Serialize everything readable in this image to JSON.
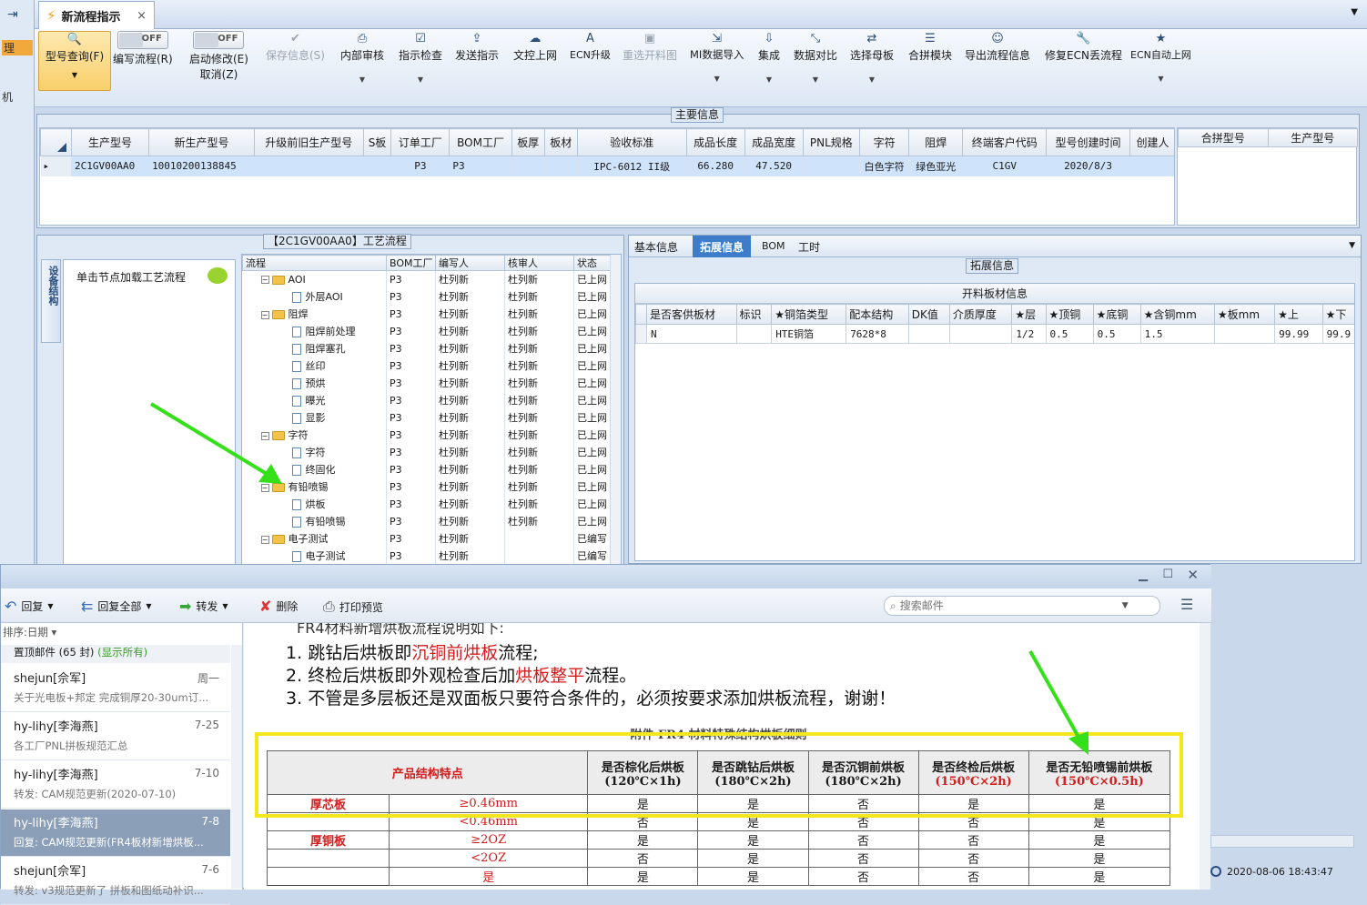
{
  "left_strip": {
    "items": [
      "理",
      "机"
    ]
  },
  "tab": {
    "title": "新流程指示",
    "close": "×"
  },
  "toolbar": {
    "query": "型号查询(F)",
    "toggle_off": "OFF",
    "edit_flow": "编写流程(R)",
    "start_modify": "启动修改(E)",
    "cancel": "取消(Z)",
    "save": "保存信息(S)",
    "internal_review": "内部审核",
    "check": "指示检查",
    "send": "发送指示",
    "upload": "文控上网",
    "ecn_upgrade": "ECN升级",
    "reselect": "重选开料图",
    "mi_import": "MI数据导入",
    "integrate": "集成",
    "compare": "数据对比",
    "select_master": "选择母板",
    "merge": "合拼模块",
    "export": "导出流程信息",
    "repair_ecn": "修复ECN丢流程",
    "ecn_auto": "ECN自动上网"
  },
  "main_info": {
    "title": "主要信息",
    "columns": [
      "生产型号",
      "新生产型号",
      "升级前旧生产型号",
      "S板",
      "订单工厂",
      "BOM工厂",
      "板厚",
      "板材",
      "验收标准",
      "成品长度",
      "成品宽度",
      "PNL规格",
      "字符",
      "阻焊",
      "终端客户代码",
      "型号创建时间",
      "创建人"
    ],
    "row": [
      "2C1GV00AA0",
      "10010200138845",
      "",
      "",
      "P3",
      "P3",
      "",
      "",
      "IPC-6012 II级",
      "66.280",
      "47.520",
      "",
      "白色字符",
      "绿色亚光",
      "C1GV",
      "2020/8/3",
      ""
    ],
    "merge_columns": [
      "合拼型号",
      "生产型号"
    ]
  },
  "process": {
    "title": "【2C1GV00AA0】工艺流程",
    "side_tab": "设备结构",
    "hint": "单击节点加载工艺流程",
    "columns": [
      "流程",
      "BOM工厂",
      "编写人",
      "核审人",
      "状态"
    ],
    "rows": [
      {
        "name": "AOI",
        "level": 0,
        "bom": "P3",
        "writer": "杜列新",
        "reviewer": "杜列新",
        "status": "已上网"
      },
      {
        "name": "外层AOI",
        "level": 1,
        "bom": "P3",
        "writer": "杜列新",
        "reviewer": "杜列新",
        "status": "已上网"
      },
      {
        "name": "阻焊",
        "level": 0,
        "bom": "P3",
        "writer": "杜列新",
        "reviewer": "杜列新",
        "status": "已上网"
      },
      {
        "name": "阻焊前处理",
        "level": 1,
        "bom": "P3",
        "writer": "杜列新",
        "reviewer": "杜列新",
        "status": "已上网"
      },
      {
        "name": "阻焊塞孔",
        "level": 1,
        "bom": "P3",
        "writer": "杜列新",
        "reviewer": "杜列新",
        "status": "已上网"
      },
      {
        "name": "丝印",
        "level": 1,
        "bom": "P3",
        "writer": "杜列新",
        "reviewer": "杜列新",
        "status": "已上网"
      },
      {
        "name": "预烘",
        "level": 1,
        "bom": "P3",
        "writer": "杜列新",
        "reviewer": "杜列新",
        "status": "已上网"
      },
      {
        "name": "曝光",
        "level": 1,
        "bom": "P3",
        "writer": "杜列新",
        "reviewer": "杜列新",
        "status": "已上网"
      },
      {
        "name": "显影",
        "level": 1,
        "bom": "P3",
        "writer": "杜列新",
        "reviewer": "杜列新",
        "status": "已上网"
      },
      {
        "name": "字符",
        "level": 0,
        "bom": "P3",
        "writer": "杜列新",
        "reviewer": "杜列新",
        "status": "已上网"
      },
      {
        "name": "字符",
        "level": 1,
        "bom": "P3",
        "writer": "杜列新",
        "reviewer": "杜列新",
        "status": "已上网"
      },
      {
        "name": "终固化",
        "level": 1,
        "bom": "P3",
        "writer": "杜列新",
        "reviewer": "杜列新",
        "status": "已上网"
      },
      {
        "name": "有铅喷锡",
        "level": 0,
        "bom": "P3",
        "writer": "杜列新",
        "reviewer": "杜列新",
        "status": "已上网"
      },
      {
        "name": "烘板",
        "level": 1,
        "bom": "P3",
        "writer": "杜列新",
        "reviewer": "杜列新",
        "status": "已上网"
      },
      {
        "name": "有铅喷锡",
        "level": 1,
        "bom": "P3",
        "writer": "杜列新",
        "reviewer": "杜列新",
        "status": "已上网"
      },
      {
        "name": "电子测试",
        "level": 0,
        "bom": "P3",
        "writer": "杜列新",
        "reviewer": "",
        "status": "已编写"
      },
      {
        "name": "电子测试",
        "level": 1,
        "bom": "P3",
        "writer": "杜列新",
        "reviewer": "",
        "status": "已编写"
      }
    ]
  },
  "right_panel": {
    "tabs": [
      "基本信息",
      "拓展信息",
      "BOM",
      "工时"
    ],
    "active_tab": "拓展信息",
    "group_title": "拓展信息",
    "table_title": "开料板材信息",
    "columns": [
      "是否客供板材",
      "标识",
      "★铜箔类型",
      "配本结构",
      "DK值",
      "介质厚度",
      "★层",
      "★顶铜",
      "★底铜",
      "★含铜mm",
      "★板mm",
      "★上",
      "★下"
    ],
    "row": [
      "N",
      "",
      "HTE铜箔",
      "7628*8",
      "",
      "",
      "1/2",
      "0.5",
      "0.5",
      "1.5",
      "",
      "99.99",
      "99.9"
    ]
  },
  "mail": {
    "toolbar": {
      "reply": "回复",
      "reply_all": "回复全部",
      "forward": "转发",
      "delete": "删除",
      "print": "打印预览",
      "search_placeholder": "搜索邮件"
    },
    "sort": "排序:日期",
    "pinned": "置顶邮件 (65 封)",
    "show_all": "(显示所有)",
    "items": [
      {
        "sender": "shejun[佘军]",
        "date": "周一",
        "subject": "关于光电板+邦定 完成铜厚20-30um订..."
      },
      {
        "sender": "hy-lihy[李海燕]",
        "date": "7-25",
        "subject": "各工厂PNL拼板规范汇总"
      },
      {
        "sender": "hy-lihy[李海燕]",
        "date": "7-10",
        "subject": "转发: CAM规范更新(2020-07-10)"
      },
      {
        "sender": "hy-lihy[李海燕]",
        "date": "7-8",
        "subject": "回复: CAM规范更新(FR4板材新增烘板..."
      },
      {
        "sender": "shejun[佘军]",
        "date": "7-6",
        "subject": "转发: v3规范更新了 拼板和图纸动补识..."
      }
    ],
    "body": {
      "intro": "FR4材料新增烘板流程说明如下:",
      "lines": [
        {
          "n": "1.",
          "pre": "跳钻后烘板即",
          "red": "沉铜前烘板",
          "post": "流程;"
        },
        {
          "n": "2.",
          "pre": "终检后烘板即外观检查后加",
          "red": "烘板整平",
          "post": "流程。"
        },
        {
          "n": "3.",
          "pre": "不管是多层板还是双面板只要符合条件的，必须按要求添加烘板流程，谢谢！",
          "red": "",
          "post": ""
        }
      ],
      "table_caption": "附件 FR4 材料特殊结构烘板细则",
      "table_headers": [
        {
          "a": "产品结构特点",
          "b": ""
        },
        {
          "a": "是否棕化后烘板",
          "b": "(120℃×1h)"
        },
        {
          "a": "是否跳钻后烘板",
          "b": "(180℃×2h)"
        },
        {
          "a": "是否沉铜前烘板",
          "b": "(180℃×2h)"
        },
        {
          "a": "是否终检后烘板",
          "b": "(150℃×2h)"
        },
        {
          "a": "是否无铅喷锡前烘板",
          "b": "(150℃×0.5h)"
        }
      ],
      "table_rows": [
        {
          "group": "厚芯板",
          "cond": "≥0.46mm",
          "v": [
            "是",
            "是",
            "否",
            "是",
            "是"
          ]
        },
        {
          "group": "",
          "cond": "<0.46mm",
          "v": [
            "否",
            "是",
            "否",
            "否",
            "是"
          ]
        },
        {
          "group": "厚铜板",
          "cond": "≥2OZ",
          "v": [
            "是",
            "是",
            "否",
            "否",
            "是"
          ]
        },
        {
          "group": "",
          "cond": "<2OZ",
          "v": [
            "否",
            "是",
            "否",
            "否",
            "是"
          ]
        },
        {
          "group": "",
          "cond": "是",
          "v": [
            "是",
            "是",
            "否",
            "否",
            "是"
          ]
        }
      ]
    },
    "status_time": "2020-08-06 18:43:47"
  },
  "colors": {
    "accent": "#2a62b0",
    "highlight": "#f3e820",
    "arrow": "#35e01b",
    "red_text": "#d21c1c"
  }
}
